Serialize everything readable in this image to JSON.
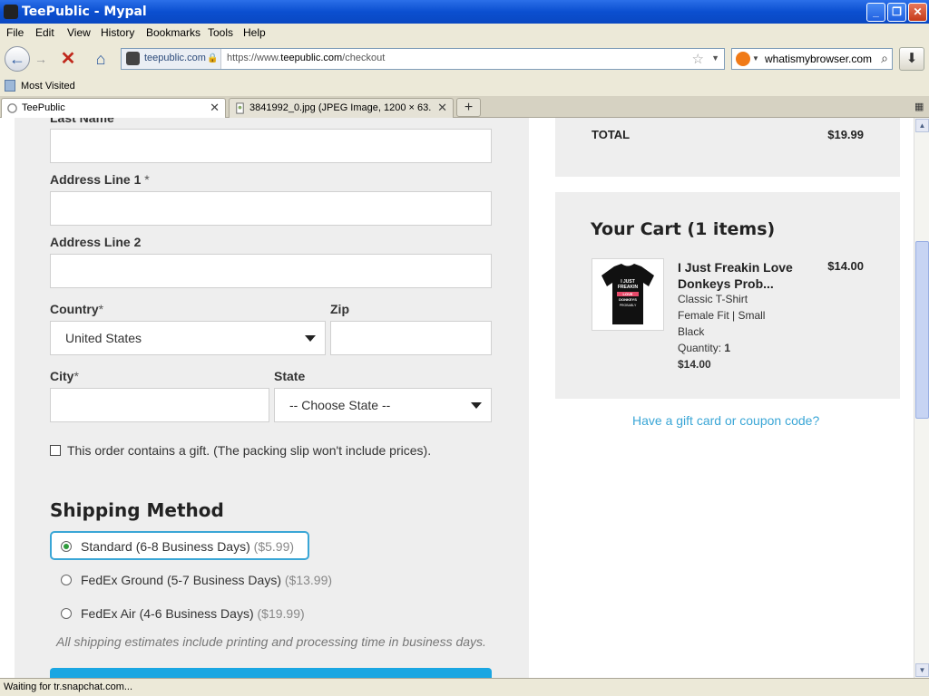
{
  "window": {
    "title": "TeePublic - Mypal"
  },
  "menu": [
    "File",
    "Edit",
    "View",
    "History",
    "Bookmarks",
    "Tools",
    "Help"
  ],
  "nav": {
    "identity_domain": "teepublic.com",
    "url_prefix": "https://www.",
    "url_host": "teepublic.com",
    "url_path": "/checkout",
    "search_query": "whatismybrowser.com"
  },
  "bookmarks": {
    "most_visited": "Most Visited"
  },
  "tabs": [
    {
      "label": "TeePublic"
    },
    {
      "label": "3841992_0.jpg (JPEG Image, 1200 × 63..."
    }
  ],
  "form": {
    "last_name_label": "Last Name",
    "address1_label": "Address Line 1",
    "address1_req": " *",
    "address2_label": "Address Line 2",
    "country_label": "Country",
    "country_req": "*",
    "country_value": "United States",
    "zip_label": "Zip",
    "city_label": "City",
    "city_req": "*",
    "state_label": "State",
    "state_value": "-- Choose State --",
    "gift_text": "This order contains a gift. (The packing slip won't include prices)."
  },
  "shipping": {
    "title": "Shipping Method",
    "options": [
      {
        "label": "Standard (6-8 Business Days)",
        "price": "($5.99)",
        "selected": true
      },
      {
        "label": "FedEx Ground (5-7 Business Days)",
        "price": "($13.99)",
        "selected": false
      },
      {
        "label": "FedEx Air (4-6 Business Days)",
        "price": "($19.99)",
        "selected": false
      }
    ],
    "note": "All shipping estimates include printing and processing time in business days."
  },
  "summary": {
    "total_label": "TOTAL",
    "total_value": "$19.99"
  },
  "cart": {
    "title": "Your Cart (1 items)",
    "item": {
      "name": "I Just Freakin Love Donkeys Prob...",
      "price": "$14.00",
      "style": "Classic T-Shirt",
      "fit": "Female Fit | Small",
      "color": "Black",
      "quantity_label": "Quantity: ",
      "quantity": "1",
      "line_total": "$14.00",
      "shirt_text": [
        "I JUST",
        "FREAKIN",
        "LOVE",
        "DONKEYS",
        "PROBABLY"
      ]
    },
    "coupon_link": "Have a gift card or coupon code?"
  },
  "status": {
    "text": "Waiting for tr.snapchat.com..."
  }
}
